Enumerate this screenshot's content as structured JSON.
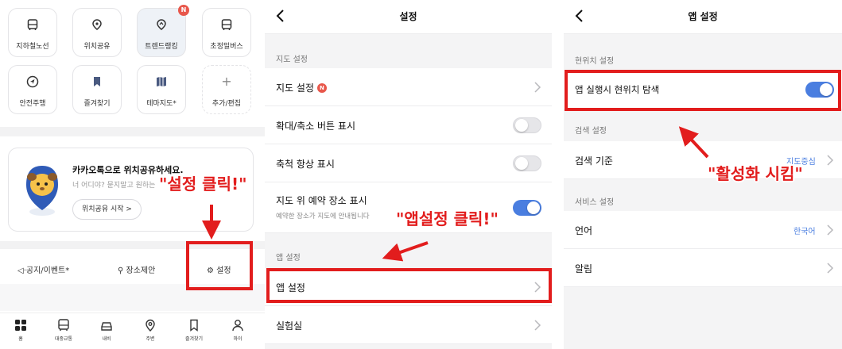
{
  "home": {
    "tiles": [
      {
        "label": "지하철노선",
        "icon": "bus-icon"
      },
      {
        "label": "위치공유",
        "icon": "location-share-icon"
      },
      {
        "label": "트렌드랭킹",
        "icon": "trend-ranking-icon",
        "badge": "N"
      },
      {
        "label": "초정밀버스",
        "icon": "bus-icon"
      },
      {
        "label": "안전주행",
        "icon": "navigation-arrow-icon"
      },
      {
        "label": "즐겨찾기",
        "icon": "bookmark-icon"
      },
      {
        "label": "테마지도*",
        "icon": "map-icon"
      },
      {
        "label": "추가/편집",
        "icon": "plus-icon",
        "symbol": "+"
      }
    ],
    "card": {
      "title": "카카오톡으로 위치공유하세요.",
      "subtitle": "너 어디야? 묻지말고 원하는",
      "button": "위치공유 시작 >"
    },
    "quick_links": {
      "notice": "공지/이벤트*",
      "suggest": "장소제안",
      "settings": "설정"
    },
    "tabs": [
      {
        "label": "홈",
        "icon": "home-icon"
      },
      {
        "label": "대중교통",
        "icon": "transit-icon"
      },
      {
        "label": "내비",
        "icon": "car-icon"
      },
      {
        "label": "주변",
        "icon": "pin-icon"
      },
      {
        "label": "즐겨찾기",
        "icon": "bookmark-icon"
      },
      {
        "label": "마이",
        "icon": "person-icon"
      }
    ]
  },
  "settings": {
    "title": "설정",
    "map_section": "지도 설정",
    "rows": {
      "map_settings": "지도 설정",
      "map_settings_badge": "N",
      "zoom_buttons": "확대/축소 버튼 표시",
      "scale_always": "축척 항상 표시",
      "reserved_places": "지도 위 예약 장소 표시",
      "reserved_places_sub": "예약한 장소가 지도에 안내됩니다"
    },
    "toggles": {
      "zoom_buttons": false,
      "scale_always": false,
      "reserved_places": true
    },
    "app_section": "앱 설정",
    "app_settings": "앱 설정",
    "lab": "실험실"
  },
  "app_settings": {
    "title": "앱 설정",
    "location_section": "현위치 설정",
    "location_search": "앱 실행시 현위치 탐색",
    "location_search_on": true,
    "search_section": "검색 설정",
    "search_basis": "검색 기준",
    "search_basis_value": "지도중심",
    "service_section": "서비스 설정",
    "language": "언어",
    "language_value": "한국어",
    "notification": "알림"
  },
  "annotations": {
    "step1": "\"설정 클릭!\"",
    "step2": "\"앱설정 클릭!\"",
    "step3": "\"활성화 시킴\""
  },
  "colors": {
    "accent": "#4a7ee0",
    "annotation": "#e21d1d",
    "badge": "#e8574b"
  }
}
